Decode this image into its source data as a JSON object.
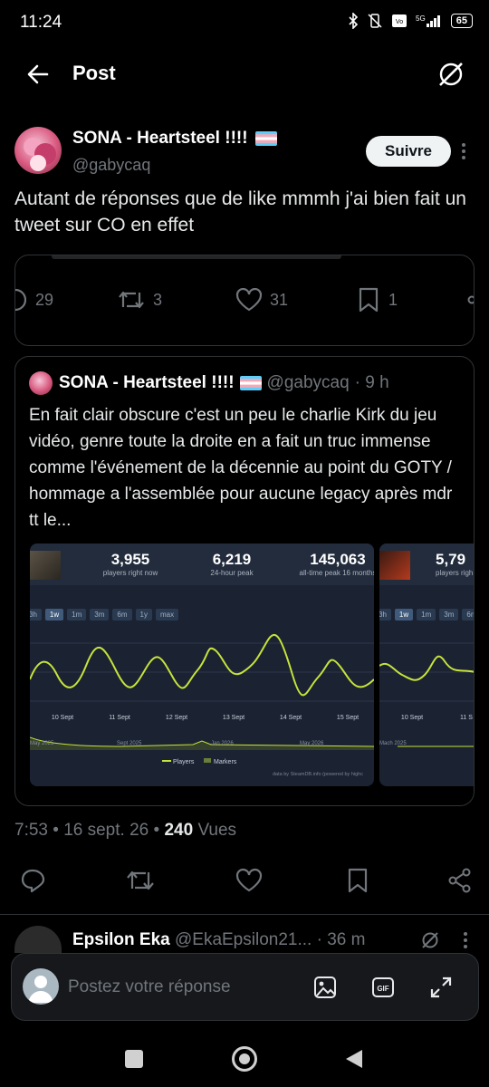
{
  "status_bar": {
    "time": "11:24",
    "battery": "65"
  },
  "header": {
    "title": "Post"
  },
  "tweet": {
    "author_name": "SONA - Heartsteel !!!!",
    "author_handle": "@gabycaq",
    "follow_label": "Suivre",
    "text": "Autant de réponses que de like mmmh j'ai bien fait un tweet sur CO en effet",
    "embedded_counts": {
      "replies": "29",
      "retweets": "3",
      "likes": "31",
      "bookmarks": "1"
    },
    "quote": {
      "author_name": "SONA - Heartsteel !!!!",
      "author_handle": "@gabycaq",
      "time": "· 9 h",
      "text": "En fait clair obscure c'est un peu le charlie Kirk du jeu vidéo, genre toute la droite en a fait un truc immense comme l'événement de la décennie au point du GOTY / hommage a l'assemblée pour aucune legacy après mdr tt le...",
      "chart1": {
        "stats": [
          {
            "value": "3,955",
            "label": "players right now"
          },
          {
            "value": "6,219",
            "label": "24-hour peak"
          },
          {
            "value": "145,063",
            "label": "all-time peak 16 months"
          }
        ],
        "ranges": [
          "3h",
          "1w",
          "1m",
          "3m",
          "6m",
          "1y",
          "max"
        ],
        "x_labels": [
          "10 Sept",
          "11 Sept",
          "12 Sept",
          "13 Sept",
          "14 Sept",
          "15 Sept"
        ],
        "overview_labels": [
          "May 2025",
          "Sept 2025",
          "Jan 2026",
          "May 2026"
        ],
        "legend": [
          "Players",
          "Markers"
        ],
        "credit": "data by SteamDB.info (powered by highc"
      },
      "chart2": {
        "stat_value": "5,79",
        "stat_label": "players righ",
        "ranges": [
          "3h",
          "1w",
          "1m",
          "3m",
          "6m"
        ],
        "x_labels": [
          "10 Sept",
          "11 S"
        ],
        "overview_label": "Mach 2025"
      }
    },
    "meta": {
      "time": "7:53",
      "date": "16 sept. 26",
      "views_count": "240",
      "views_label": "Vues"
    }
  },
  "reply": {
    "author_name": "Epsilon Eka",
    "author_handle": "@EkaEpsilon21...",
    "time": "· 36 m"
  },
  "compose": {
    "placeholder": "Postez votre réponse"
  },
  "colors": {
    "accent_line": "#c6e33b",
    "card_border": "#2f3336",
    "muted": "#71767b"
  }
}
